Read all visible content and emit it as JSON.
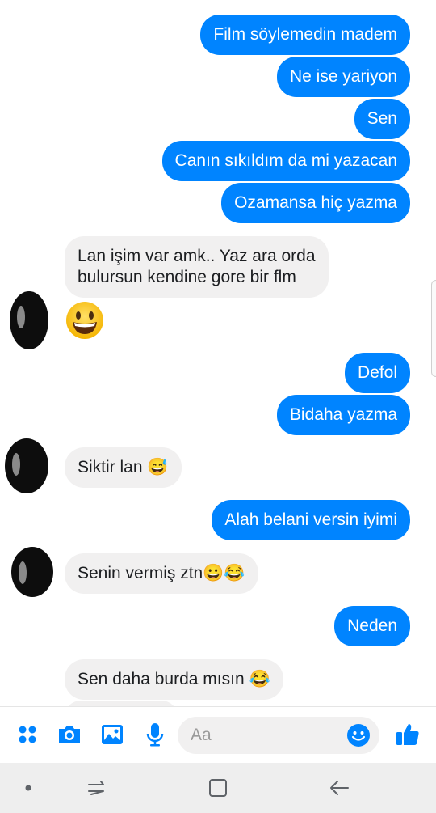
{
  "messages": [
    {
      "side": "out",
      "text": "Film söylemedin madem"
    },
    {
      "side": "out",
      "text": "Ne ise yariyon"
    },
    {
      "side": "out",
      "text": "Sen"
    },
    {
      "side": "out",
      "text": "Canın sıkıldım da mi yazacan"
    },
    {
      "side": "out",
      "text": "Ozamansa hiç yazma"
    },
    {
      "side": "in",
      "line1": "Lan işim var amk.. Yaz ara orda",
      "line2": "bulursun kendine gore bir flm"
    },
    {
      "side": "out",
      "text": "Defol"
    },
    {
      "side": "out",
      "text": "Bidaha yazma"
    },
    {
      "side": "in",
      "text": "Siktir lan 😅"
    },
    {
      "side": "out",
      "text": "Alah belani versin iyimi"
    },
    {
      "side": "in",
      "text": "Senin vermiş ztn😀😂"
    },
    {
      "side": "out",
      "text": "Neden"
    },
    {
      "side": "in",
      "text": "Sen daha burda mısın 😂"
    }
  ],
  "composer": {
    "placeholder": "Aa"
  },
  "icons": {
    "apps": "apps-grid-icon",
    "camera": "camera-icon",
    "gallery": "image-icon",
    "mic": "microphone-icon",
    "emoji": "emoji-icon",
    "like": "thumbs-up-icon"
  },
  "colors": {
    "accent": "#0084ff",
    "incoming_bubble": "#f1f0f0"
  }
}
